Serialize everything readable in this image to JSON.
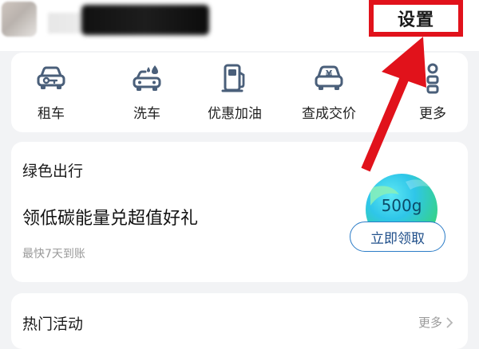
{
  "header": {
    "username": "",
    "settings_label": "设置"
  },
  "services": [
    {
      "label": "租车",
      "icon": "car-key-icon"
    },
    {
      "label": "洗车",
      "icon": "car-wash-icon"
    },
    {
      "label": "优惠加油",
      "icon": "fuel-pump-icon"
    },
    {
      "label": "查成交价",
      "icon": "car-price-icon"
    },
    {
      "label": "更多",
      "icon": "more-grid-icon"
    }
  ],
  "green_travel": {
    "title": "绿色出行",
    "headline": "领低碳能量兑超值好礼",
    "subtitle": "最快7天到账",
    "energy_amount": "500g",
    "claim_label": "立即领取"
  },
  "hot_activities": {
    "title": "热门活动",
    "more_label": "更多"
  },
  "annotation": {
    "highlight_color": "#e1121b"
  }
}
